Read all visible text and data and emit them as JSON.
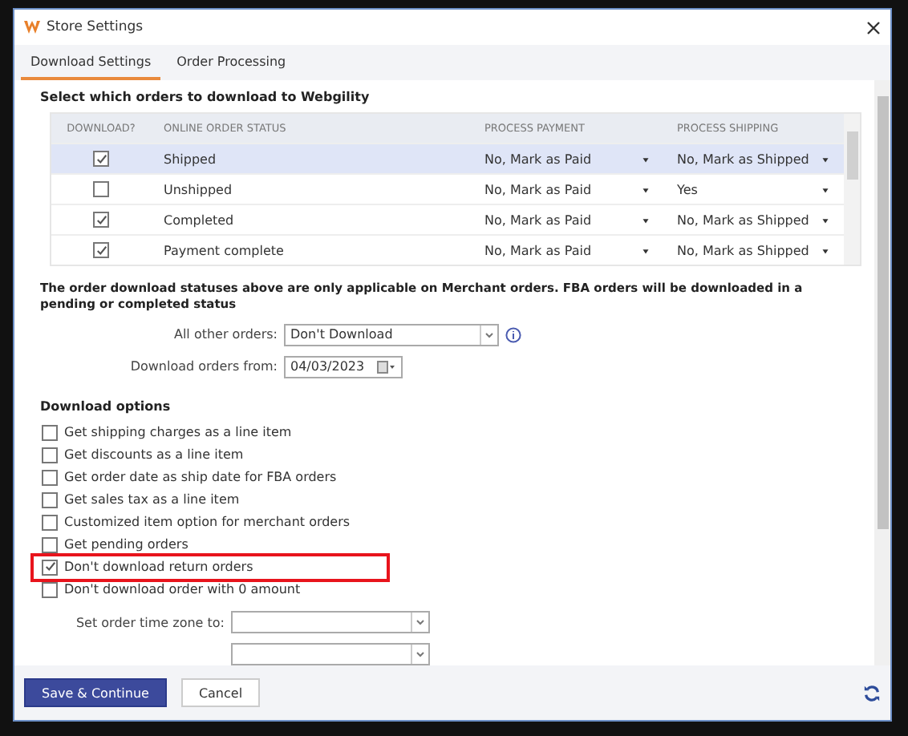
{
  "window": {
    "title": "Store Settings"
  },
  "tabs": [
    {
      "label": "Download Settings",
      "selected": true
    },
    {
      "label": "Order Processing",
      "selected": false
    }
  ],
  "order_section": {
    "heading": "Select which orders to download to Webgility",
    "columns": [
      "DOWNLOAD?",
      "ONLINE ORDER STATUS",
      "PROCESS PAYMENT",
      "PROCESS SHIPPING"
    ],
    "rows": [
      {
        "download": true,
        "status": "Shipped",
        "payment": "No, Mark as Paid",
        "shipping": "No, Mark as Shipped",
        "selected": true
      },
      {
        "download": false,
        "status": "Unshipped",
        "payment": "No, Mark as Paid",
        "shipping": "Yes",
        "selected": false
      },
      {
        "download": true,
        "status": "Completed",
        "payment": "No, Mark as Paid",
        "shipping": "No, Mark as Shipped",
        "selected": false
      },
      {
        "download": true,
        "status": "Payment complete",
        "payment": "No, Mark as Paid",
        "shipping": "No, Mark as Shipped",
        "selected": false
      }
    ]
  },
  "note": "The order download statuses above are only applicable on Merchant orders. FBA orders will be downloaded in a pending or completed status",
  "all_other_orders": {
    "label": "All other orders:",
    "value": "Don't Download"
  },
  "download_from": {
    "label": "Download orders from:",
    "value": "04/03/2023"
  },
  "options_heading": "Download options",
  "options": [
    {
      "label": "Get shipping charges as a line item",
      "checked": false,
      "highlighted": false
    },
    {
      "label": "Get discounts as a line item",
      "checked": false,
      "highlighted": false
    },
    {
      "label": "Get order date as ship date for FBA orders",
      "checked": false,
      "highlighted": false
    },
    {
      "label": "Get sales tax as a line item",
      "checked": false,
      "highlighted": false
    },
    {
      "label": "Customized item option for merchant orders",
      "checked": false,
      "highlighted": false
    },
    {
      "label": "Get pending orders",
      "checked": false,
      "highlighted": false
    },
    {
      "label": "Don't download return orders",
      "checked": true,
      "highlighted": true
    },
    {
      "label": "Don't download order with 0 amount",
      "checked": false,
      "highlighted": false
    }
  ],
  "time_zone": {
    "label": "Set order time zone to:"
  },
  "buttons": [
    {
      "label": "Save & Continue",
      "kind": "primary"
    },
    {
      "label": "Cancel",
      "kind": "secondary"
    }
  ]
}
